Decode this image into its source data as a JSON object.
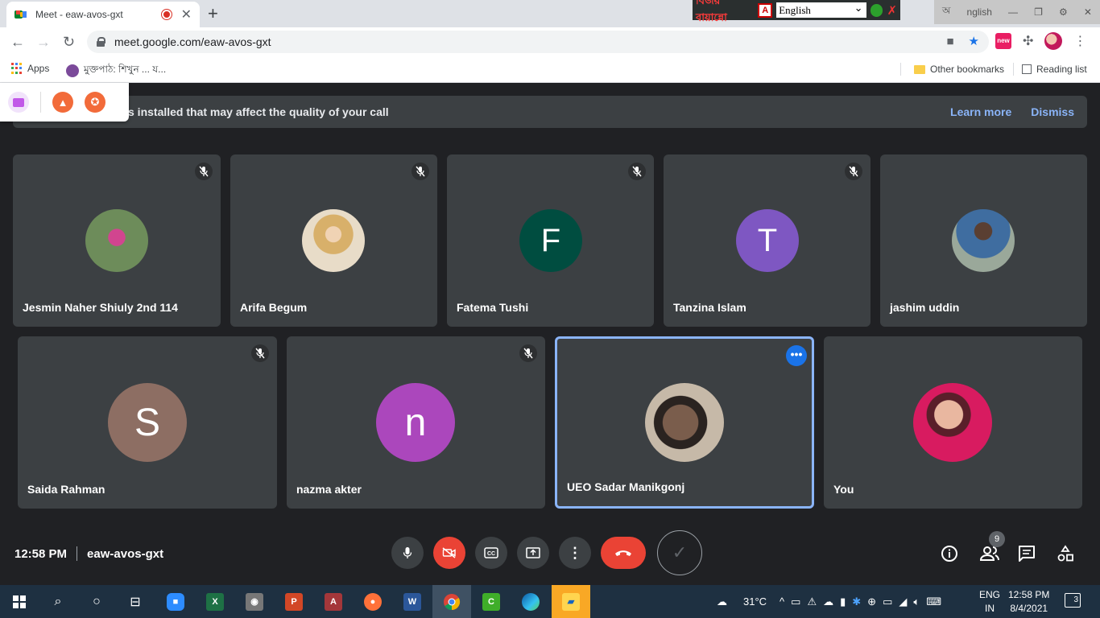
{
  "browser": {
    "tab_title": "Meet - eaw-avos-gxt",
    "url": "meet.google.com/eaw-avos-gxt",
    "new_tab_symbol": "+",
    "bookmarks": {
      "apps": "Apps",
      "item1": "মুক্তপাঠ: শিখুন ... য...",
      "other": "Other bookmarks",
      "reading": "Reading list"
    },
    "ext_new_label": "new"
  },
  "language_bar": {
    "bangla_label": "বিজয় বায়ান্নো",
    "selected_language": "English",
    "window_lang_label": "nglish"
  },
  "banner": {
    "message": "s installed that may affect the quality of your call",
    "learn_more": "Learn more",
    "dismiss": "Dismiss"
  },
  "participants_row1": [
    {
      "name": "Jesmin Naher Shiuly 2nd 114",
      "initial": "",
      "muted": true,
      "avatar_color": "#6d8c5a"
    },
    {
      "name": "Arifa Begum",
      "initial": "",
      "muted": true,
      "avatar_color": "#d7c2a6"
    },
    {
      "name": "Fatema Tushi",
      "initial": "F",
      "muted": true,
      "avatar_color": "#004d40"
    },
    {
      "name": "Tanzina Islam",
      "initial": "T",
      "muted": true,
      "avatar_color": "#7e57c2"
    },
    {
      "name": "jashim uddin",
      "initial": "",
      "muted": false,
      "avatar_color": "#5a6f6f"
    }
  ],
  "participants_row2": [
    {
      "name": "Saida Rahman",
      "initial": "S",
      "muted": true,
      "avatar_color": "#8d6e63"
    },
    {
      "name": "nazma akter",
      "initial": "n",
      "muted": true,
      "avatar_color": "#ab47bc"
    },
    {
      "name": "UEO Sadar Manikgonj",
      "initial": "",
      "muted": false,
      "avatar_color": "#7a5d4c"
    },
    {
      "name": "You",
      "initial": "",
      "muted": false,
      "avatar_color": "#d81b60"
    }
  ],
  "meeting": {
    "time": "12:58 PM",
    "code": "eaw-avos-gxt",
    "participant_count": "9"
  },
  "taskbar": {
    "temperature": "31°C",
    "lang_top": "ENG",
    "lang_bottom": "IN",
    "time": "12:58 PM",
    "date": "8/4/2021",
    "notifications": "3"
  }
}
